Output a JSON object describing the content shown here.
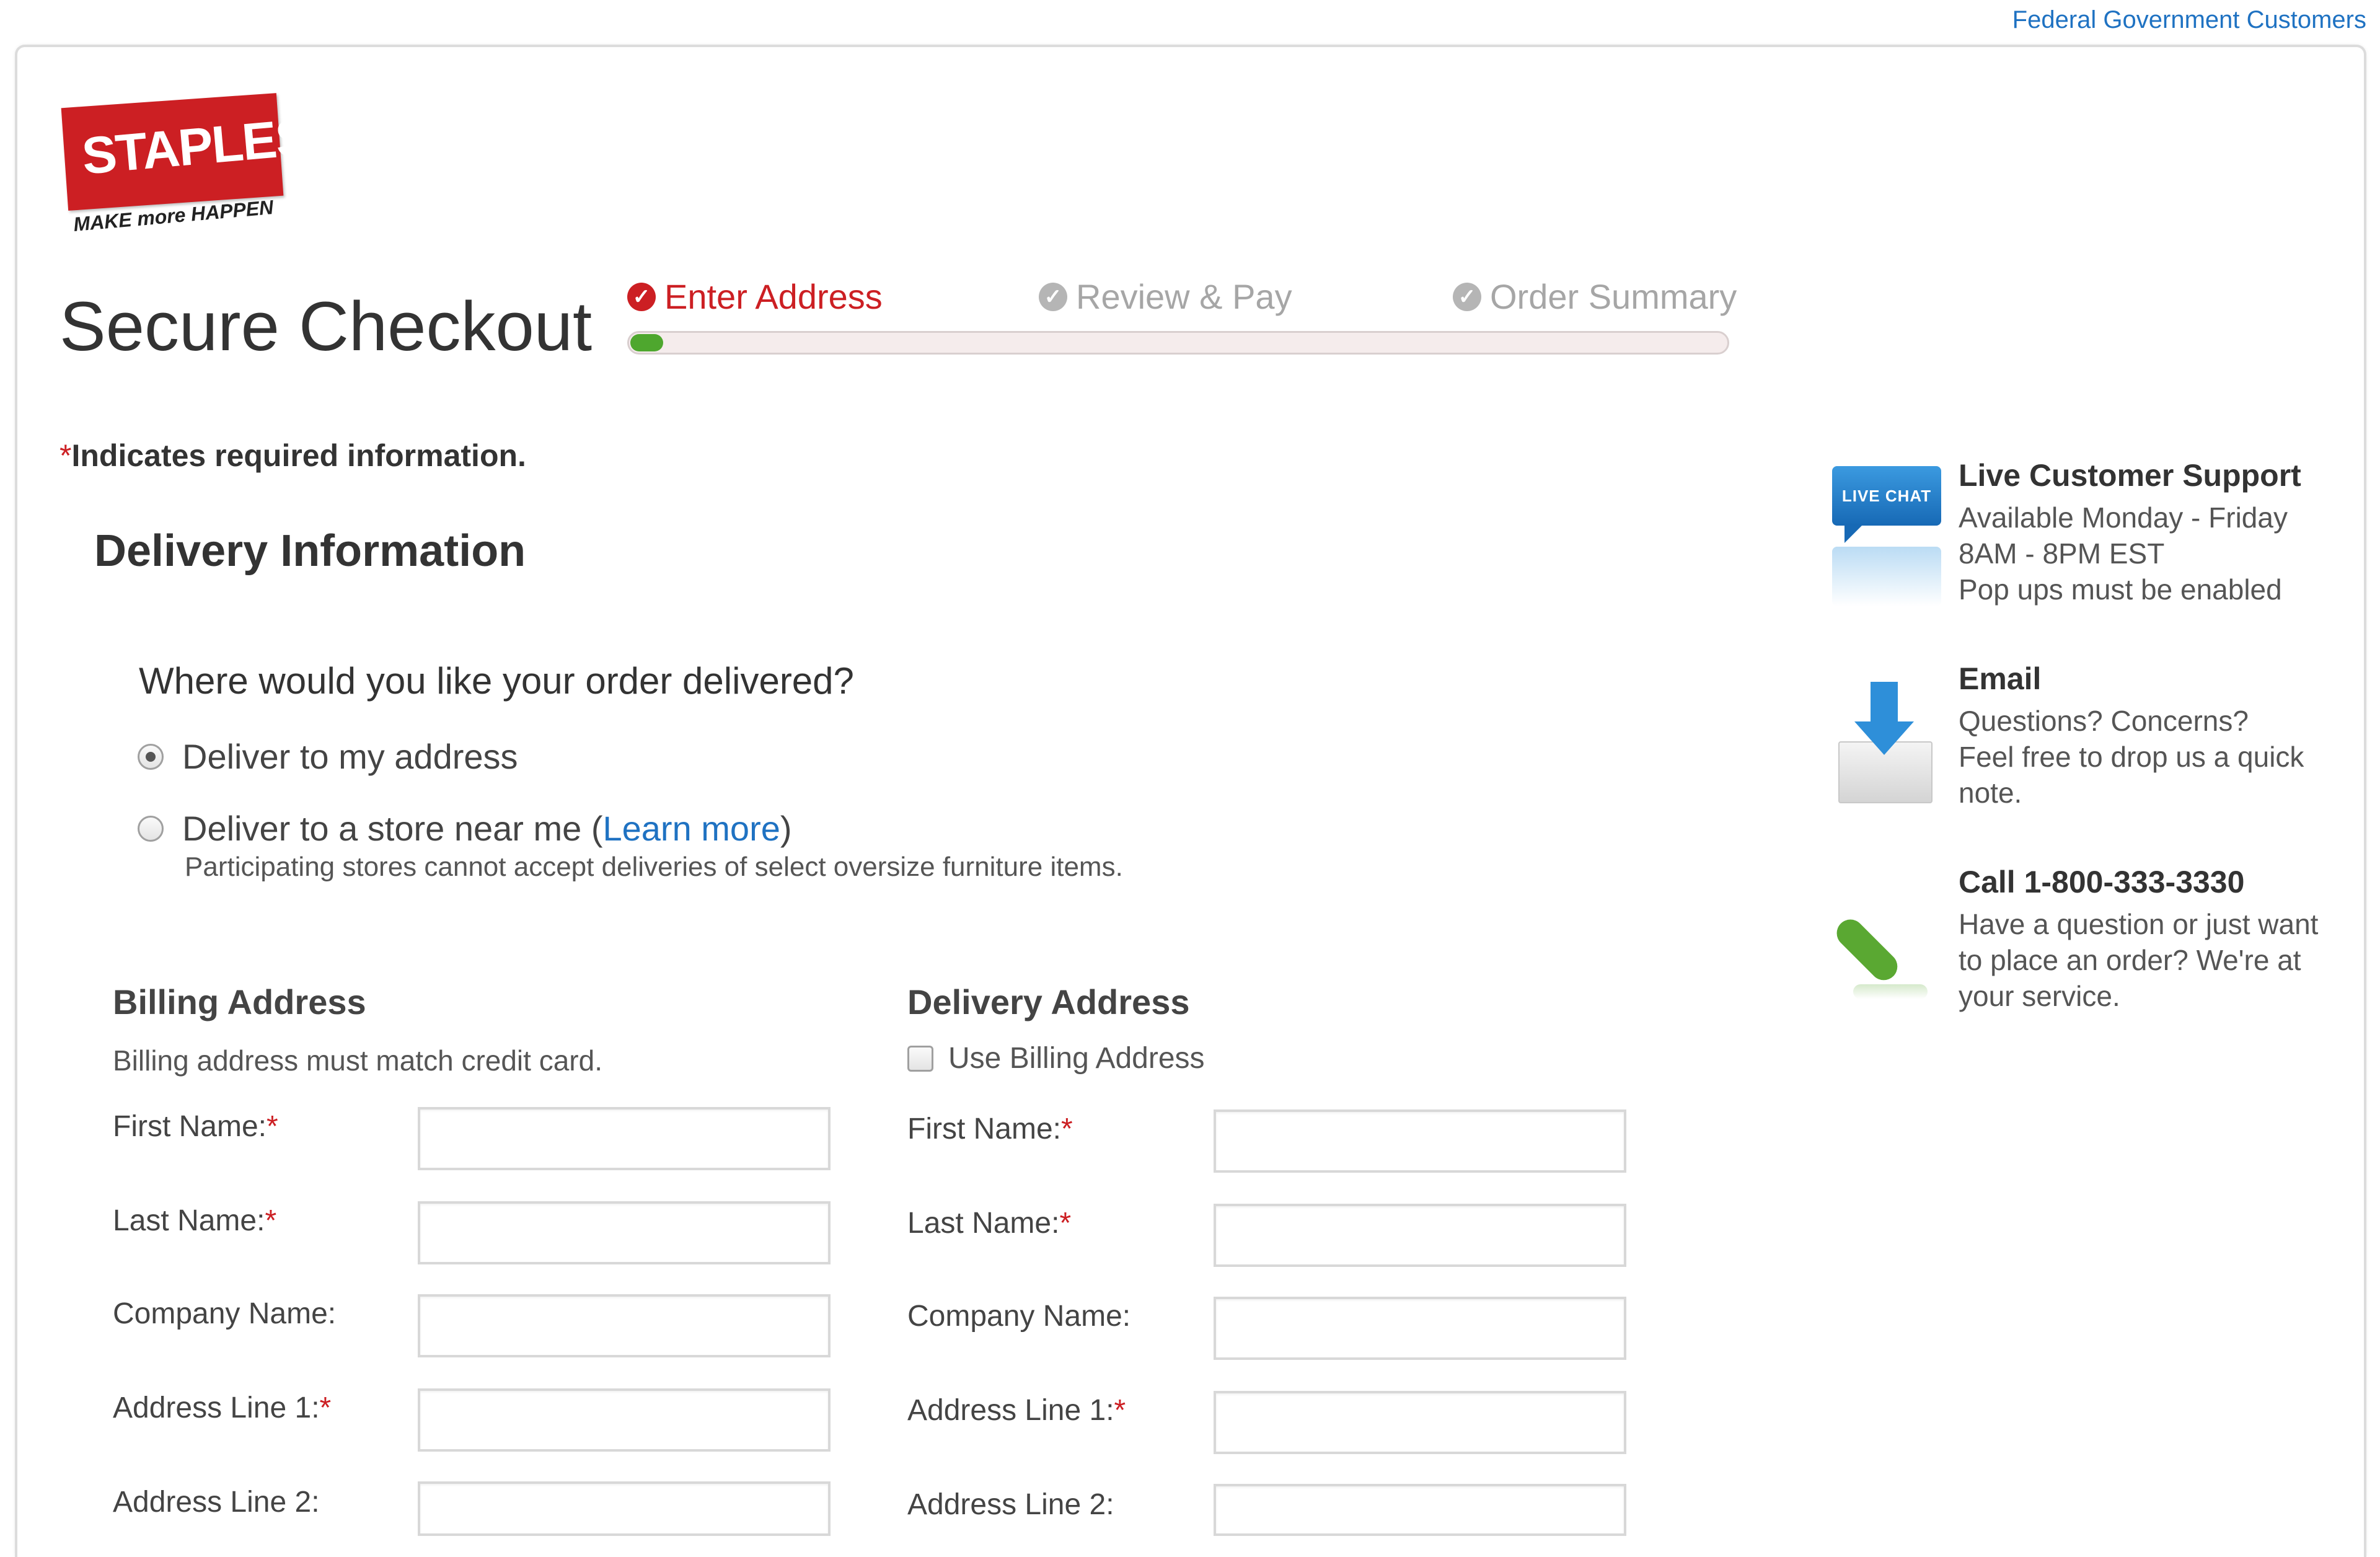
{
  "top_link": "Federal Government Customers",
  "logo": {
    "brand": "STAPLES",
    "tagline": "MAKE more HAPPEN"
  },
  "page_title": "Secure Checkout",
  "progress": {
    "steps": [
      {
        "label": "Enter Address",
        "state": "active"
      },
      {
        "label": "Review & Pay",
        "state": "pending"
      },
      {
        "label": "Order Summary",
        "state": "pending"
      }
    ],
    "fill_fraction": 0.03
  },
  "required_note": {
    "star": "*",
    "text": "Indicates required information."
  },
  "delivery_info": {
    "title": "Delivery Information",
    "question": "Where would you like your order delivered?",
    "options": [
      {
        "label": "Deliver to my address",
        "selected": true
      },
      {
        "label": "Deliver to a store near me (",
        "link": "Learn more",
        "suffix": ")",
        "selected": false
      }
    ],
    "store_note": "Participating stores cannot accept deliveries of select oversize furniture items."
  },
  "billing": {
    "title": "Billing Address",
    "note": "Billing address must match credit card.",
    "fields": [
      {
        "label": "First Name:",
        "required": "*",
        "value": ""
      },
      {
        "label": "Last Name:",
        "required": "*",
        "value": ""
      },
      {
        "label": "Company Name:",
        "required": "",
        "value": ""
      },
      {
        "label": "Address Line 1:",
        "required": "*",
        "value": ""
      },
      {
        "label": "Address Line 2:",
        "required": "",
        "value": ""
      }
    ]
  },
  "delivery": {
    "title": "Delivery Address",
    "use_billing_label": "Use Billing Address",
    "fields": [
      {
        "label": "First Name:",
        "required": "*",
        "value": ""
      },
      {
        "label": "Last Name:",
        "required": "*",
        "value": ""
      },
      {
        "label": "Company Name:",
        "required": "",
        "value": ""
      },
      {
        "label": "Address Line 1:",
        "required": "*",
        "value": ""
      },
      {
        "label": "Address Line 2:",
        "required": "",
        "value": ""
      }
    ]
  },
  "support": {
    "chat": {
      "badge": "LIVE CHAT",
      "title": "Live Customer Support",
      "lines": [
        "Available Monday - Friday",
        "8AM - 8PM EST",
        "Pop ups must be enabled"
      ]
    },
    "email": {
      "title": "Email",
      "lines": [
        "Questions? Concerns?",
        "Feel free to drop us a quick",
        "note."
      ]
    },
    "call": {
      "title": "Call 1-800-333-3330",
      "lines": [
        "Have a question or just want",
        "to place an order? We're at",
        "your service."
      ]
    }
  },
  "colors": {
    "brand_red": "#cc1f23",
    "link_blue": "#1f72c2",
    "progress_green": "#4ea72e"
  },
  "icons": [
    "check-circle-icon",
    "live-chat-icon",
    "email-icon",
    "phone-icon"
  ]
}
